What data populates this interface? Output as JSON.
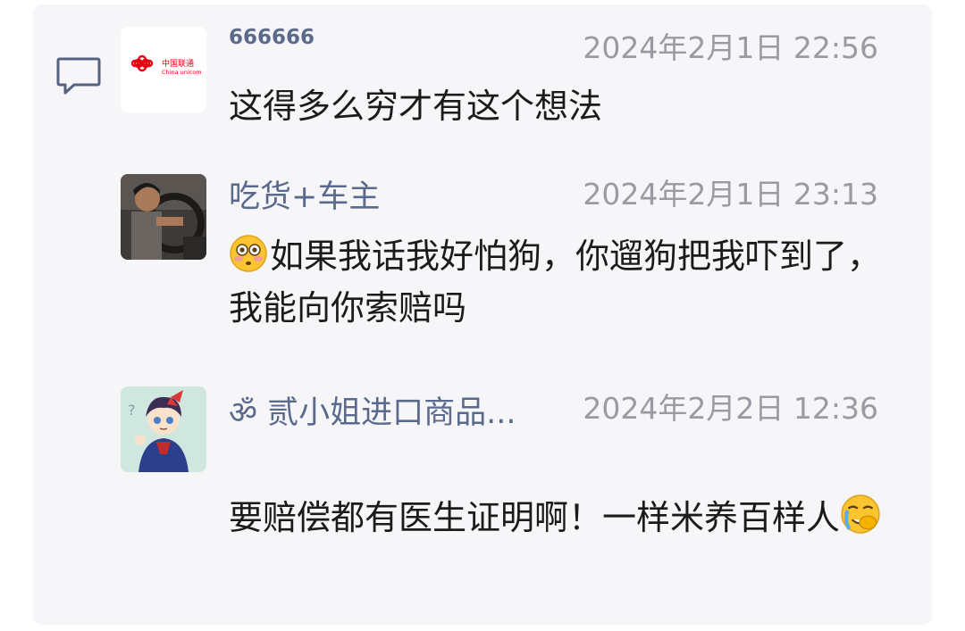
{
  "comments": [
    {
      "username": "666666",
      "timestamp": "2024年2月1日 22:56",
      "text": "这得多么穷才有这个想法",
      "avatar": {
        "icon": "china-unicom-logo",
        "brand_cn": "中国联通",
        "brand_en": "China unicom",
        "brand_color": "#e60012"
      }
    },
    {
      "username": "吃货+车主",
      "timestamp": "2024年2月1日 23:13",
      "emoji": "flushed-face-emoji",
      "text": "如果我话我好怕狗，你遛狗把我吓到了，我能向你索赔吗",
      "avatar": {
        "icon": "driver-photo-avatar"
      }
    },
    {
      "username": "贰小姐进口商品...",
      "username_prefix_glyph": "ॐ",
      "timestamp": "2024年2月2日 12:36",
      "text": "要赔偿都有医生证明啊！一样米养百样人",
      "emoji": "loudly-crying-face-emoji",
      "avatar": {
        "icon": "anime-character-avatar"
      }
    }
  ],
  "colors": {
    "panel_bg": "#f6f6f8",
    "username": "#5a6a8c",
    "timestamp": "#9a9ba2",
    "text": "#1b1b1b"
  }
}
